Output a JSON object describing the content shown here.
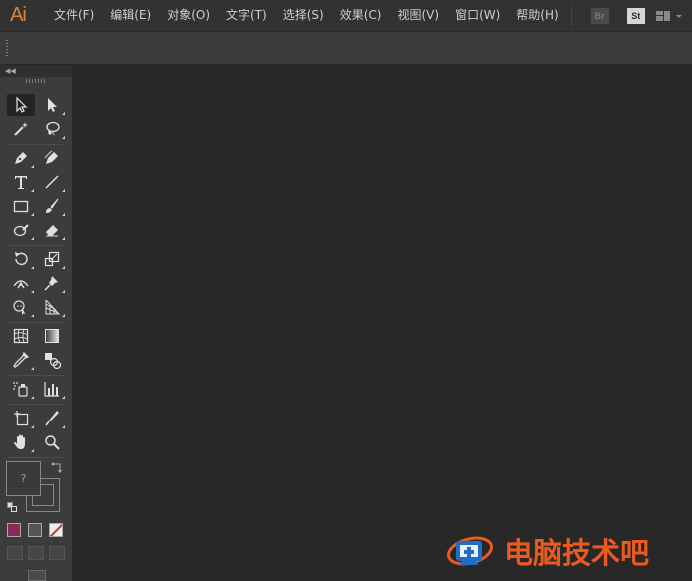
{
  "app": {
    "logo_text": "Ai",
    "accent": "#d9883a"
  },
  "menubar": {
    "items": [
      {
        "label": "文件(F)",
        "name": "menu-file"
      },
      {
        "label": "编辑(E)",
        "name": "menu-edit"
      },
      {
        "label": "对象(O)",
        "name": "menu-object"
      },
      {
        "label": "文字(T)",
        "name": "menu-type"
      },
      {
        "label": "选择(S)",
        "name": "menu-select"
      },
      {
        "label": "效果(C)",
        "name": "menu-effect"
      },
      {
        "label": "视图(V)",
        "name": "menu-view"
      },
      {
        "label": "窗口(W)",
        "name": "menu-window"
      },
      {
        "label": "帮助(H)",
        "name": "menu-help"
      }
    ],
    "bridge_label": "Br",
    "stock_label": "St",
    "workspace_icon": "workspace-layout-icon"
  },
  "toolbar": {
    "collapse_icon": "double-chevron-left-icon",
    "tools": [
      {
        "name": "selection-tool",
        "icon": "arrow-outline-icon",
        "active": true
      },
      {
        "name": "direct-selection-tool",
        "icon": "arrow-solid-icon",
        "active": false
      },
      {
        "name": "magic-wand-tool",
        "icon": "magic-wand-icon",
        "active": false
      },
      {
        "name": "lasso-tool",
        "icon": "lasso-icon",
        "active": false
      },
      {
        "name": "pen-tool",
        "icon": "pen-icon",
        "active": false
      },
      {
        "name": "curvature-tool",
        "icon": "curvature-pen-icon",
        "active": false
      },
      {
        "name": "type-tool",
        "icon": "type-T-icon",
        "active": false
      },
      {
        "name": "line-segment-tool",
        "icon": "line-icon",
        "active": false
      },
      {
        "name": "rectangle-tool",
        "icon": "rectangle-icon",
        "active": false
      },
      {
        "name": "paintbrush-tool",
        "icon": "brush-icon",
        "active": false
      },
      {
        "name": "shaper-tool",
        "icon": "shaper-icon",
        "active": false
      },
      {
        "name": "eraser-tool",
        "icon": "eraser-icon",
        "active": false
      },
      {
        "name": "rotate-tool",
        "icon": "rotate-icon",
        "active": false
      },
      {
        "name": "scale-tool",
        "icon": "scale-icon",
        "active": false
      },
      {
        "name": "width-tool",
        "icon": "width-icon",
        "active": false
      },
      {
        "name": "puppet-warp-tool",
        "icon": "pushpin-icon",
        "active": false
      },
      {
        "name": "shape-builder-tool",
        "icon": "shape-builder-icon",
        "active": false
      },
      {
        "name": "perspective-grid-tool",
        "icon": "perspective-grid-icon",
        "active": false
      },
      {
        "name": "mesh-tool",
        "icon": "mesh-icon",
        "active": false
      },
      {
        "name": "gradient-tool",
        "icon": "gradient-icon",
        "active": false
      },
      {
        "name": "eyedropper-tool",
        "icon": "eyedropper-icon",
        "active": false
      },
      {
        "name": "blend-tool",
        "icon": "blend-icon",
        "active": false
      },
      {
        "name": "symbol-sprayer-tool",
        "icon": "symbol-sprayer-icon",
        "active": false
      },
      {
        "name": "column-graph-tool",
        "icon": "bar-graph-icon",
        "active": false
      },
      {
        "name": "artboard-tool",
        "icon": "artboard-icon",
        "active": false
      },
      {
        "name": "slice-tool",
        "icon": "slice-knife-icon",
        "active": false
      },
      {
        "name": "hand-tool",
        "icon": "hand-icon",
        "active": false
      },
      {
        "name": "zoom-tool",
        "icon": "magnifier-icon",
        "active": false
      }
    ],
    "fill_stroke": {
      "fill_placeholder": "?",
      "fill_color": "#3a3a3a"
    },
    "color_modes": [
      {
        "name": "color-mode-button",
        "color": "#8a2a5a"
      },
      {
        "name": "gradient-mode-button",
        "color": "#555555"
      },
      {
        "name": "none-mode-button",
        "color": "#c0392b"
      }
    ]
  },
  "watermark": {
    "text": "电脑技术吧",
    "color": "#ec5a1d"
  }
}
